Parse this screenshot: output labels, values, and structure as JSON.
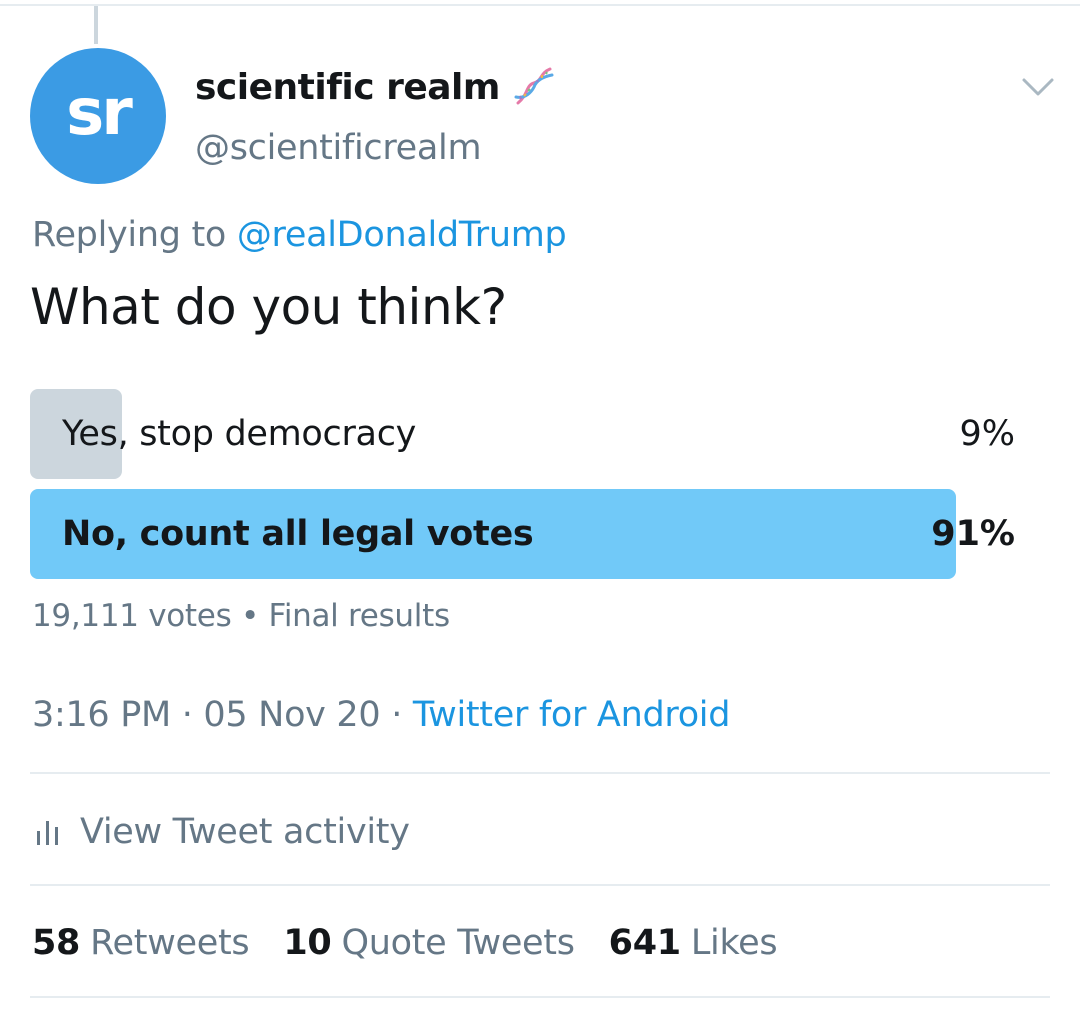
{
  "colors": {
    "brand_blue": "#1b95e0",
    "avatar_blue": "#3b9be4",
    "poll_winner": "#71c9f8",
    "poll_loser": "#ccd6dd",
    "text_primary": "#14171a",
    "text_secondary": "#657786"
  },
  "author": {
    "avatar_text": "sr",
    "display_name": "scientific realm",
    "name_emoji_icon": "dna-icon",
    "handle": "@scientificrealm"
  },
  "menu_icon": "chevron-down-icon",
  "reply": {
    "prefix": "Replying to",
    "mention": "@realDonaldTrump"
  },
  "tweet_text": "What do you think?",
  "poll": {
    "options": [
      {
        "label": "Yes, stop democracy",
        "percent_text": "9%",
        "percent": 9,
        "winner": false
      },
      {
        "label": "No, count all legal votes",
        "percent_text": "91%",
        "percent": 91,
        "winner": true
      }
    ],
    "votes": "19,111 votes",
    "separator": "•",
    "status": "Final results"
  },
  "meta": {
    "time": "3:16 PM",
    "separator": "·",
    "date": "05 Nov 20",
    "source": "Twitter for Android"
  },
  "activity": {
    "icon": "bar-chart-icon",
    "label": "View Tweet activity"
  },
  "stats": {
    "retweets_count": "58",
    "retweets_label": "Retweets",
    "quotes_count": "10",
    "quotes_label": "Quote Tweets",
    "likes_count": "641",
    "likes_label": "Likes"
  }
}
